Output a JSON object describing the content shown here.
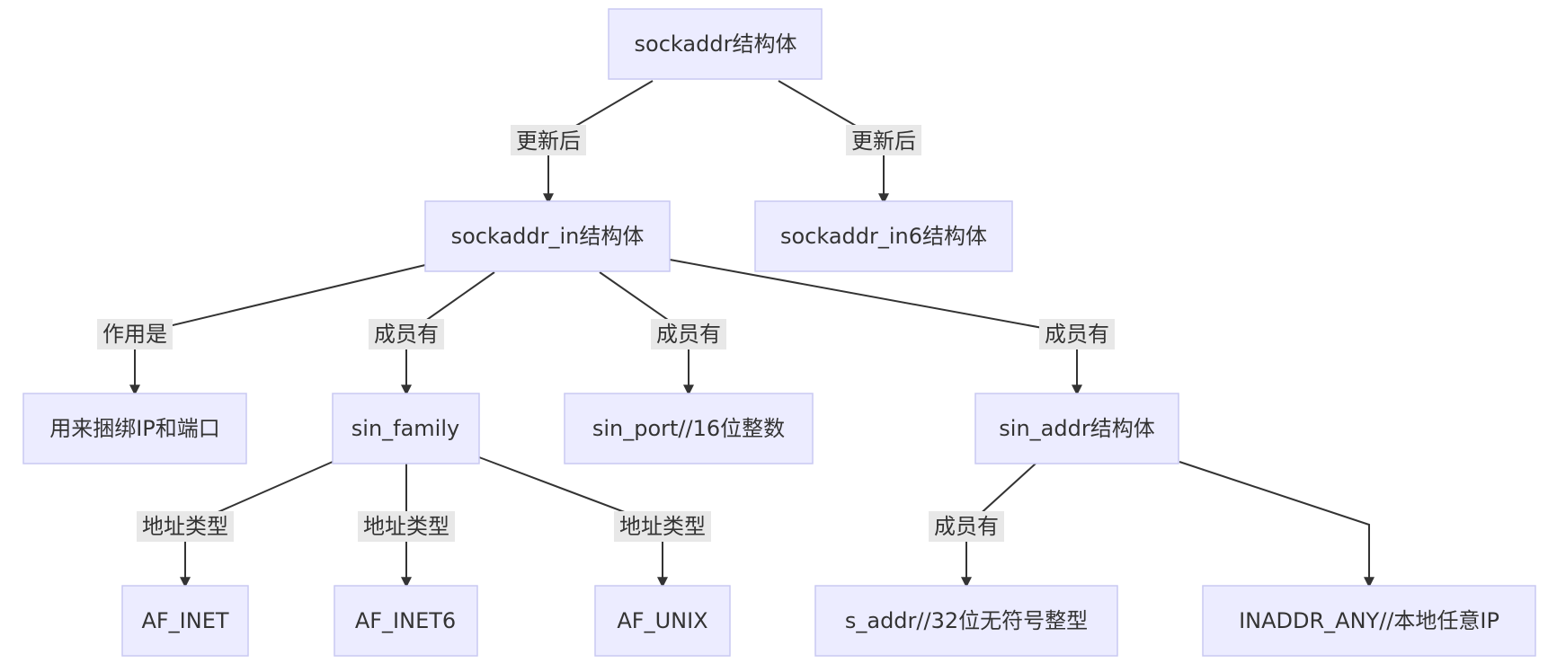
{
  "nodes": {
    "sockaddr": "sockaddr结构体",
    "sockaddr_in": "sockaddr_in结构体",
    "sockaddr_in6": "sockaddr_in6结构体",
    "purpose": "用来捆绑IP和端口",
    "sin_family": "sin_family",
    "sin_port": "sin_port//16位整数",
    "sin_addr": "sin_addr结构体",
    "af_inet": "AF_INET",
    "af_inet6": "AF_INET6",
    "af_unix": "AF_UNIX",
    "s_addr": "s_addr//32位无符号整型",
    "inaddr_any": "INADDR_ANY//本地任意IP"
  },
  "edges": {
    "sockaddr_to_in": "更新后",
    "sockaddr_to_in6": "更新后",
    "in_to_purpose": "作用是",
    "in_to_family": "成员有",
    "in_to_port": "成员有",
    "in_to_addr": "成员有",
    "family_to_inet": "地址类型",
    "family_to_inet6": "地址类型",
    "family_to_unix": "地址类型",
    "addr_to_saddr": "成员有"
  },
  "colors": {
    "node_fill": "#ececff",
    "node_stroke": "#c9c9f2",
    "edge": "#333333",
    "label_bg": "#e8e8e8"
  }
}
